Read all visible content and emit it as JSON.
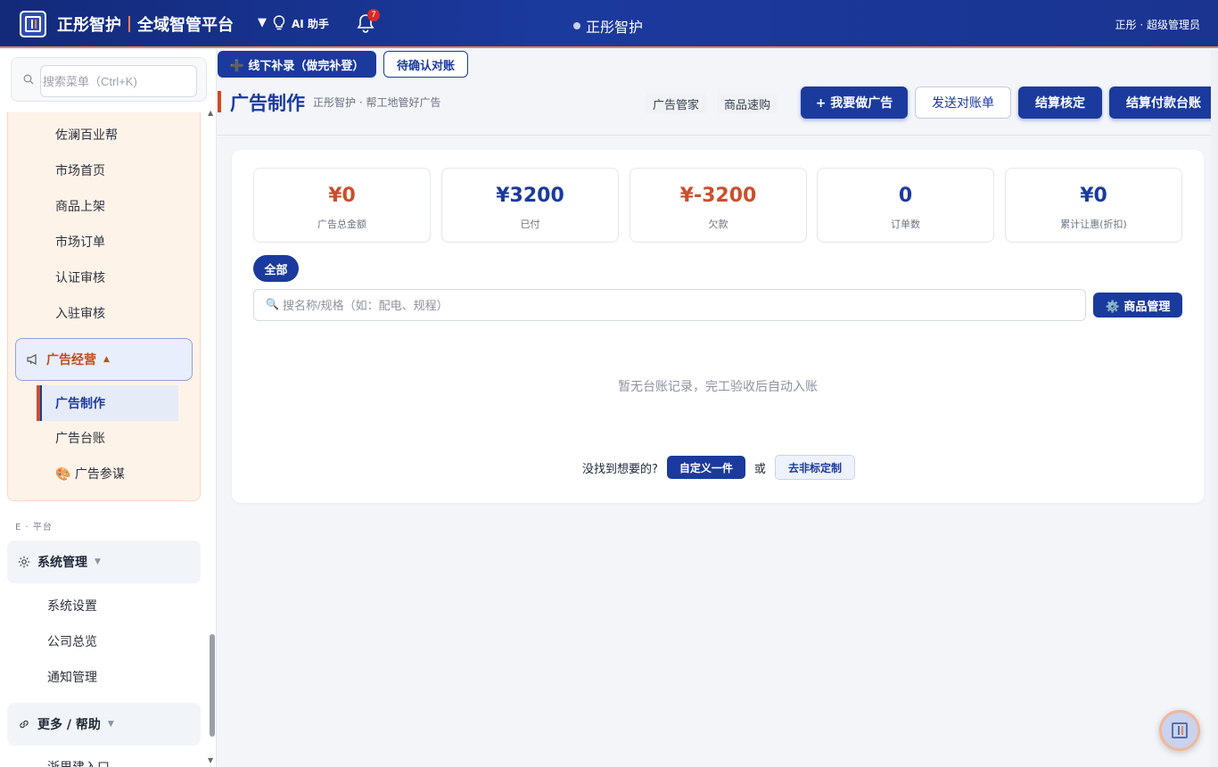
{
  "header": {
    "brand": "正彤智护",
    "platform": "全域智管平台",
    "ai_label": "AI 助手",
    "notif_count": "7",
    "center_title": "正彤智护",
    "user": "正彤 · 超级管理员"
  },
  "sidebar": {
    "search_placeholder": "搜索菜单（Ctrl+K)",
    "items_top": [
      "佐澜百业帮",
      "市场首页",
      "商品上架",
      "市场订单",
      "认证审核",
      "入驻审核"
    ],
    "ad_group": "广告经营",
    "ad_items": {
      "active": "广告制作",
      "ledger": "广告台账",
      "advisor": "🎨 广告参谋"
    },
    "section_label": "E · 平台",
    "sys_group": "系统管理",
    "sys_items": [
      "系统设置",
      "公司总览",
      "通知管理"
    ],
    "more_group": "更多 / 帮助",
    "more_items": [
      "浙里建入口"
    ]
  },
  "toolbar": {
    "offline_label": "➕ 线下补录（做完补登）",
    "pending_label": "待确认对账"
  },
  "page": {
    "title": "广告制作",
    "subtitle": "正彤智护 · 帮工地管好广告",
    "tabs": [
      "广告管家",
      "商品速购"
    ],
    "buttons": {
      "make_ad": "+ 我要做广告",
      "send_statement": "发送对账单",
      "settle_check": "结算核定",
      "settle_ledger": "结算付款台账"
    }
  },
  "stats": [
    {
      "value": "¥0",
      "label": "广告总金额",
      "color": "#c9502b"
    },
    {
      "value": "¥3200",
      "label": "已付",
      "color": "#1b3a9e"
    },
    {
      "value": "¥-3200",
      "label": "欠款",
      "color": "#c9502b"
    },
    {
      "value": "0",
      "label": "订单数",
      "color": "#1b3a9e"
    },
    {
      "value": "¥0",
      "label": "累计让惠(折扣)",
      "color": "#1b3a9e"
    }
  ],
  "filter": {
    "all": "全部"
  },
  "goods": {
    "search_placeholder": "搜名称/规格（如：配电、规程）",
    "manage_label": "⚙️ 商品管理"
  },
  "empty_text": "暂无台账记录，完工验收后自动入账",
  "not_found": {
    "prompt": "没找到想要的?",
    "custom": "自定义一件",
    "or": "或",
    "nonstd": "去非标定制"
  },
  "colors": {
    "primary": "#1b3a9e",
    "accent": "#c9502b"
  }
}
